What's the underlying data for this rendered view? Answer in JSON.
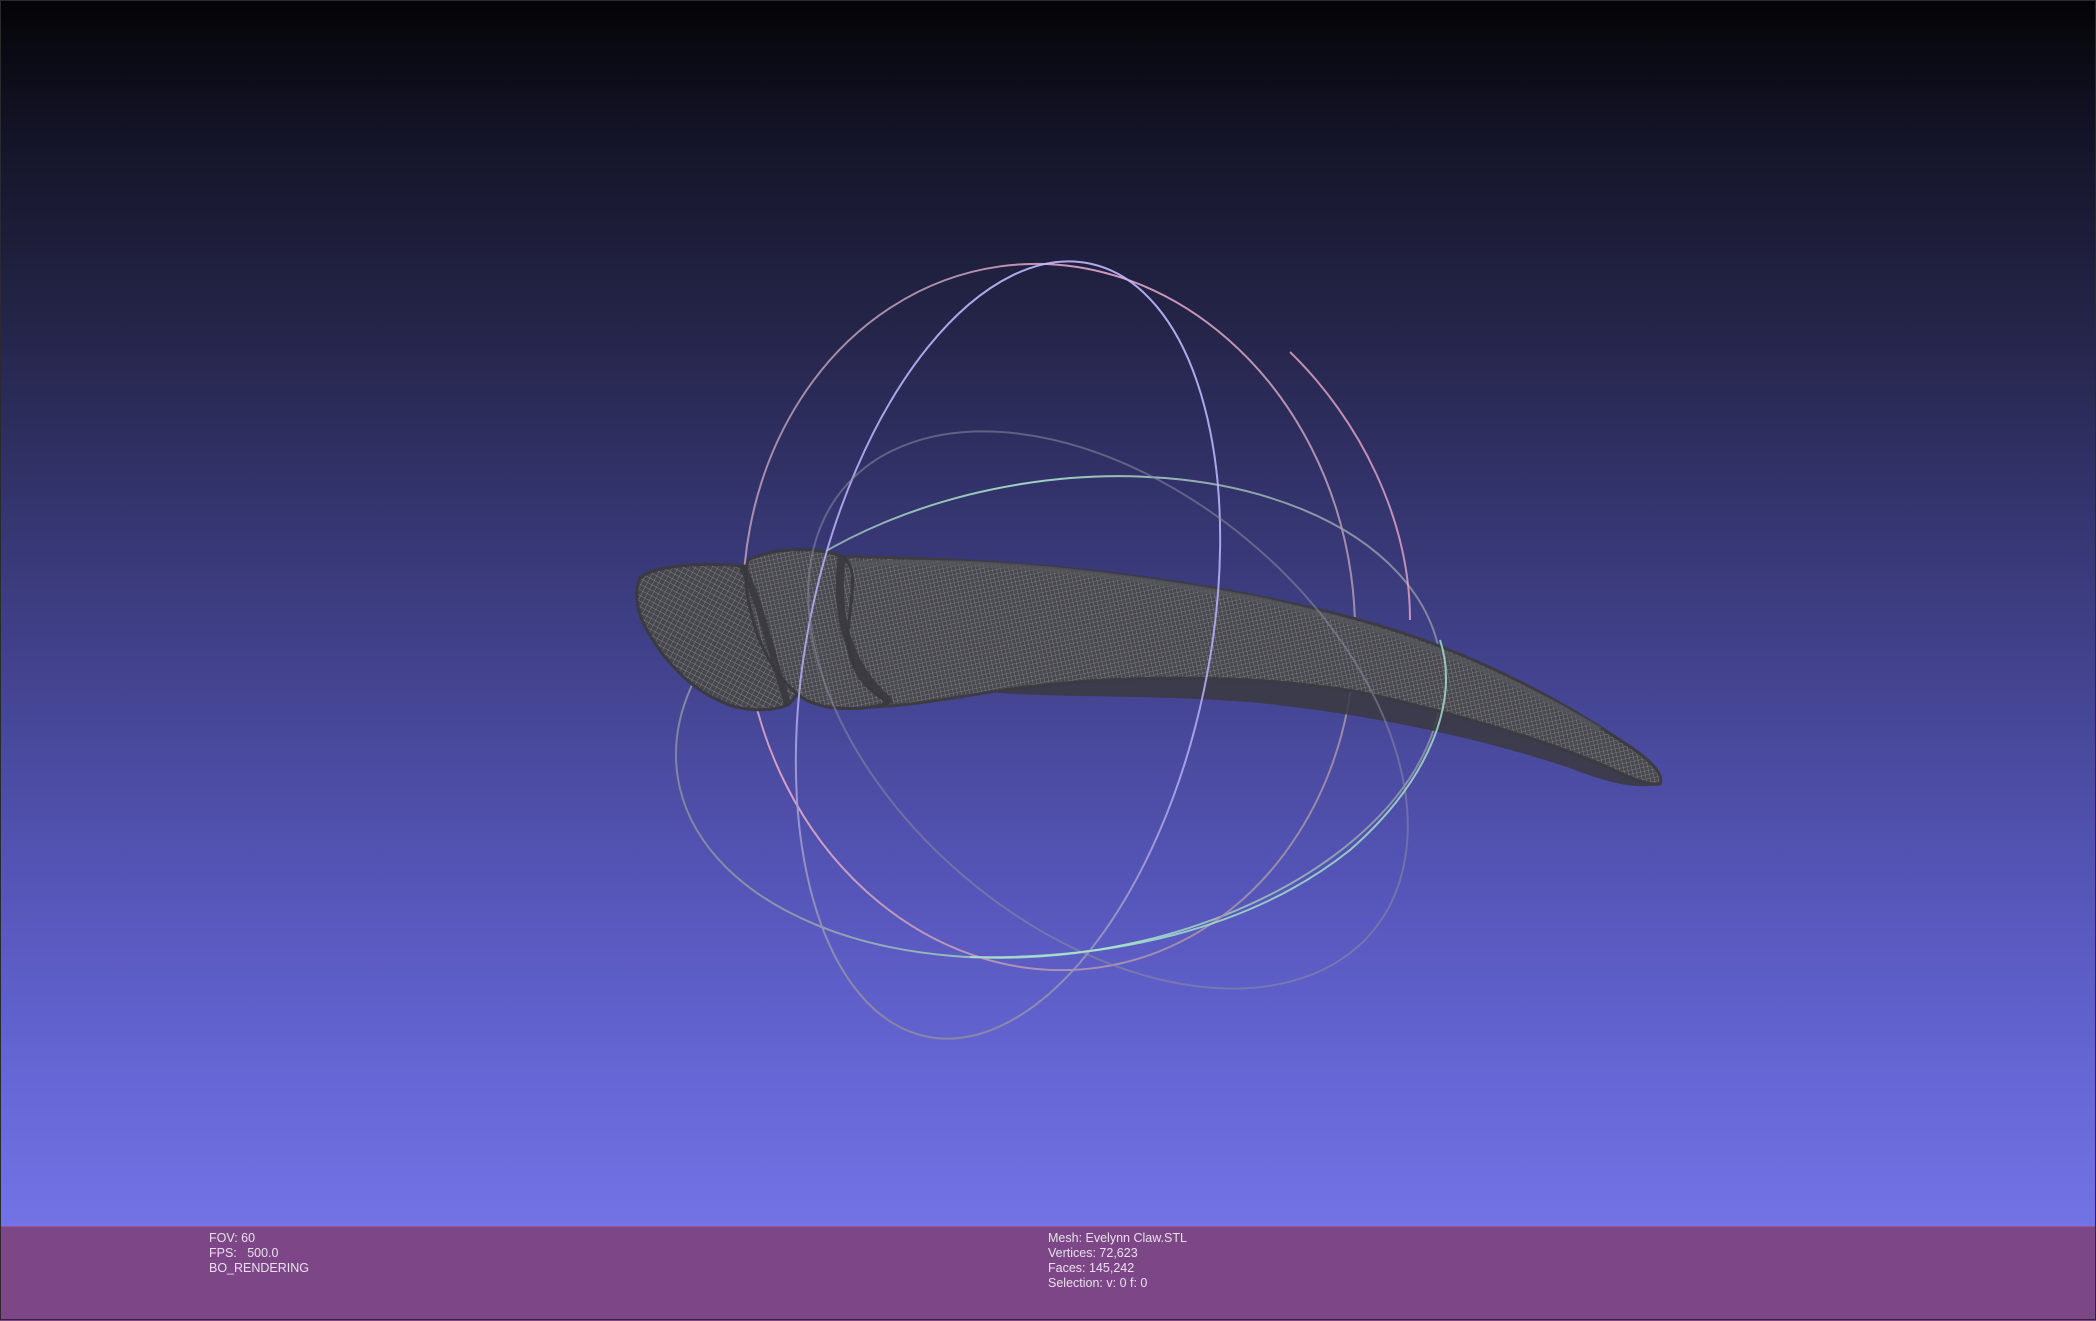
{
  "viewer": {
    "background_top": "#040406",
    "background_bottom": "#7373e6",
    "mesh_color": "#3e3e44",
    "mesh_wire_color": "#9a9aa6",
    "trackball_colors": {
      "red": "#e6a8c8",
      "green": "#a8e6cc",
      "blue": "#b0a8f0",
      "gray": "#8a8aa0"
    }
  },
  "status": {
    "bar_color": "#7d4787",
    "fov": "FOV: 60",
    "fps": "FPS:   500.0",
    "render_mode": "BO_RENDERING",
    "mesh_name": "Mesh: Evelynn Claw.STL",
    "vertices": "Vertices: 72,623",
    "faces": "Faces: 145,242",
    "selection": "Selection: v: 0 f: 0"
  }
}
